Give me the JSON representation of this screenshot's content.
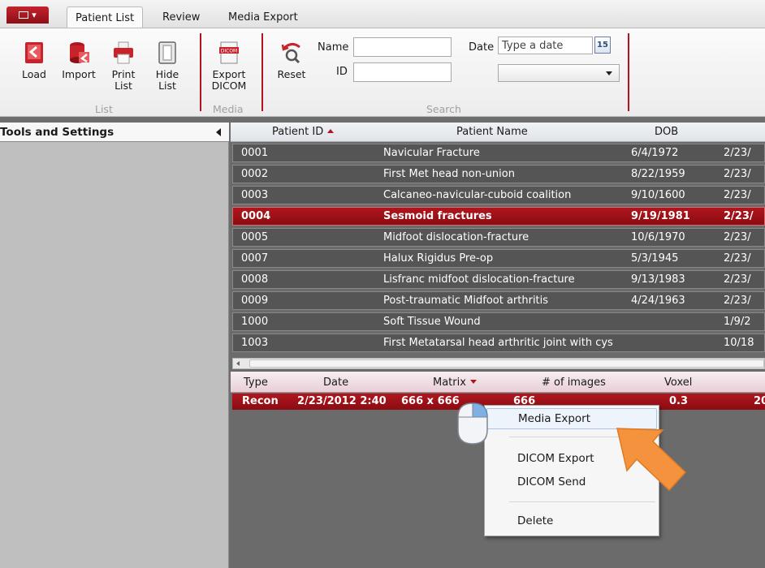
{
  "tabs": [
    {
      "label": "Patient List",
      "active": true
    },
    {
      "label": "Review",
      "active": false
    },
    {
      "label": "Media Export",
      "active": false
    }
  ],
  "ribbon": {
    "buttons": {
      "load": "Load",
      "import": "Import",
      "print_list_1": "Print",
      "print_list_2": "List",
      "hide_list_1": "Hide",
      "hide_list_2": "List",
      "export_dicom_1": "Export",
      "export_dicom_2": "DICOM",
      "reset": "Reset"
    },
    "groups": {
      "list": "List",
      "media": "Media",
      "search": "Search"
    },
    "search": {
      "name_label": "Name",
      "id_label": "ID",
      "date_label": "Date",
      "date_placeholder": "Type a date",
      "calendar_day": "15",
      "name_value": "",
      "id_value": "",
      "combo_value": ""
    }
  },
  "left_panel": {
    "title": "Tools and Settings"
  },
  "patients": {
    "columns": [
      "Patient ID",
      "Patient Name",
      "DOB"
    ],
    "sorted_column": "Patient ID",
    "rows": [
      {
        "id": "0001",
        "name": "Navicular Fracture",
        "dob": "6/4/1972",
        "date": "2/23/"
      },
      {
        "id": "0002",
        "name": "First Met head non-union",
        "dob": "8/22/1959",
        "date": "2/23/"
      },
      {
        "id": "0003",
        "name": "Calcaneo-navicular-cuboid coalition",
        "dob": "9/10/1600",
        "date": "2/23/"
      },
      {
        "id": "0004",
        "name": "Sesmoid fractures",
        "dob": "9/19/1981",
        "date": "2/23/"
      },
      {
        "id": "0005",
        "name": "Midfoot dislocation-fracture",
        "dob": "10/6/1970",
        "date": "2/23/"
      },
      {
        "id": "0007",
        "name": "Halux Rigidus Pre-op",
        "dob": "5/3/1945",
        "date": "2/23/"
      },
      {
        "id": "0008",
        "name": "Lisfranc midfoot dislocation-fracture",
        "dob": "9/13/1983",
        "date": "2/23/"
      },
      {
        "id": "0009",
        "name": "Post-traumatic Midfoot arthritis",
        "dob": "4/24/1963",
        "date": "2/23/"
      },
      {
        "id": "1000",
        "name": "Soft Tissue Wound",
        "dob": "",
        "date": "1/9/2"
      },
      {
        "id": "1003",
        "name": "First Metatarsal head arthritic joint with cys",
        "dob": "",
        "date": "10/18"
      }
    ],
    "selected_id": "0004"
  },
  "series": {
    "columns": [
      "Type",
      "Date",
      "Matrix",
      "# of images",
      "Voxel"
    ],
    "sorted_column": "Matrix",
    "rows": [
      {
        "type": "Recon",
        "date": "2/23/2012 2:40",
        "matrix": "666 x 666",
        "images": "666",
        "voxel": "0.3",
        "extra": "20"
      }
    ]
  },
  "context_menu": {
    "items": [
      "Media Export",
      "DICOM Export",
      "DICOM Send",
      "Delete"
    ],
    "highlighted": "Media Export"
  },
  "colors": {
    "accent": "#b0141c",
    "row_dark": "#555555",
    "panel_gray": "#bfbfbf",
    "pointer_arrow": "#f5923e"
  }
}
